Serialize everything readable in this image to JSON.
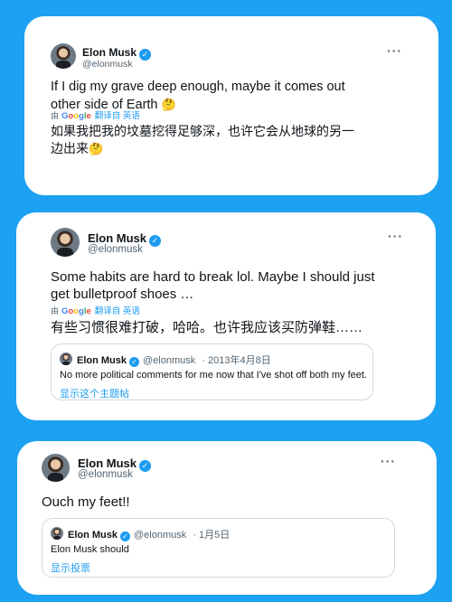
{
  "tweets": [
    {
      "name": "Elon Musk",
      "handle": "@elonmusk",
      "more": "···",
      "text_line1": "If I dig my grave deep enough, maybe it comes out",
      "text_line2": "other side of Earth",
      "emoji": "🤔",
      "translate_prefix": "由",
      "translate_google": "Google",
      "translate_suffix": "翻译自 英语",
      "translated_line1": "如果我把我的坟墓挖得足够深，也许它会从地球的另一",
      "translated_line2": "边出来"
    },
    {
      "name": "Elon Musk",
      "handle": "@elonmusk",
      "more": "···",
      "text_line1": "Some habits are hard to break lol.  Maybe I should just",
      "text_line2": "get bulletproof shoes …",
      "translate_prefix": "由",
      "translate_google": "Google",
      "translate_suffix": "翻译自 英语",
      "translated_line1": "有些习惯很难打破，哈哈。也许我应该买防弹鞋……",
      "quote": {
        "name": "Elon Musk",
        "handle": "@elonmusk",
        "date": "· 2013年4月8日",
        "text": "No more political comments for me now that I've shot off both my feet.",
        "link": "显示这个主题帖"
      }
    },
    {
      "name": "Elon Musk",
      "handle": "@elonmusk",
      "more": "···",
      "text_line1": "Ouch my feet!!",
      "quote": {
        "name": "Elon Musk",
        "handle": "@elonmusk",
        "date": "· 1月5日",
        "text": "Elon Musk should",
        "link": "显示投票"
      }
    }
  ],
  "colors": {
    "background": "#1da1f2",
    "accent": "#1d9bf0",
    "text": "#0f1419",
    "secondary": "#536471"
  }
}
